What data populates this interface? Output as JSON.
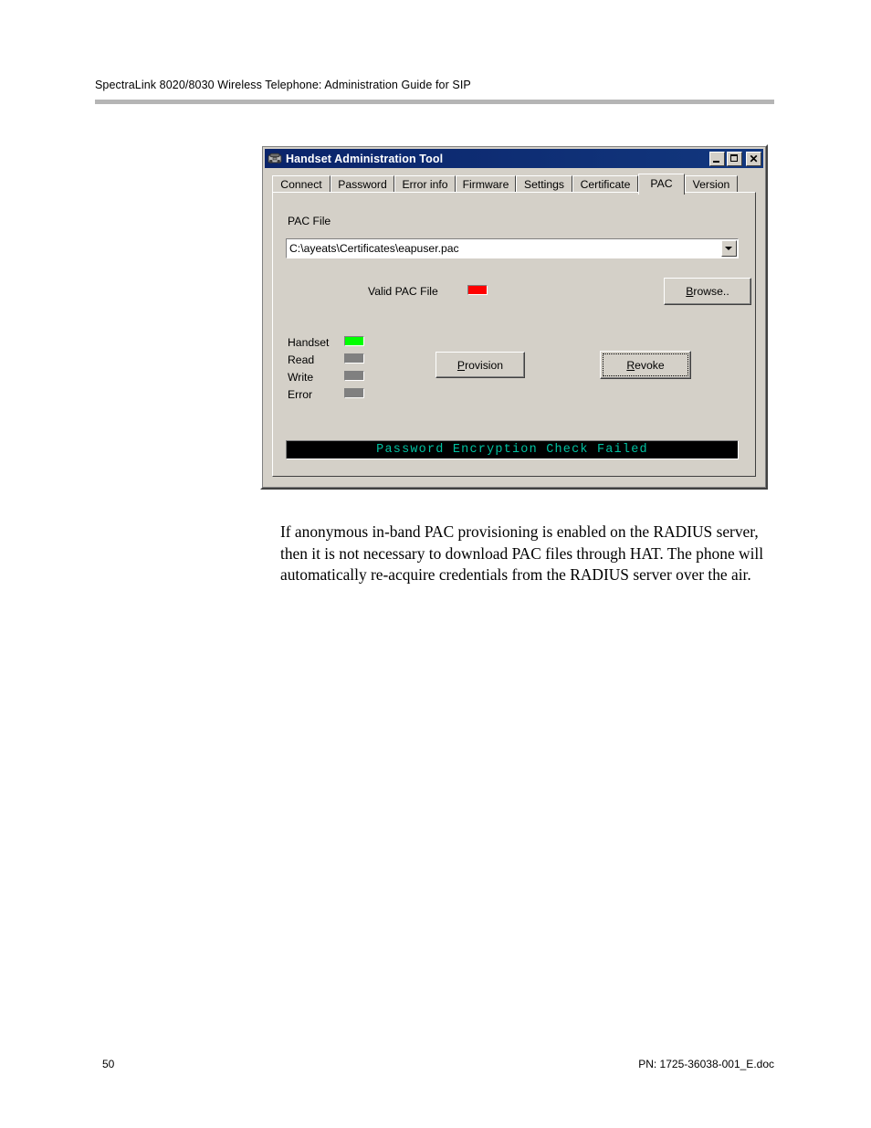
{
  "page": {
    "header_text": "SpectraLink 8020/8030 Wireless Telephone: Administration Guide for SIP",
    "footer_page_number": "50",
    "footer_document_id": "PN: 1725-36038-001_E.doc",
    "body_paragraph": "If anonymous in-band PAC provisioning is enabled on the RADIUS server, then it is not necessary to download PAC files through HAT. The phone will automatically re-acquire credentials from the RADIUS server over the air."
  },
  "dialog": {
    "title": "Handset Administration Tool",
    "title_icon": "telephone-handset-icon",
    "window_controls": {
      "minimize": "minimize-icon",
      "maximize": "maximize-icon",
      "close": "close-icon"
    },
    "tabs": [
      {
        "label": "Connect",
        "active": false
      },
      {
        "label": "Password",
        "active": false
      },
      {
        "label": "Error info",
        "active": false
      },
      {
        "label": "Firmware",
        "active": false
      },
      {
        "label": "Settings",
        "active": false
      },
      {
        "label": "Certificate",
        "active": false
      },
      {
        "label": "PAC",
        "active": true
      },
      {
        "label": "Version",
        "active": false
      }
    ],
    "pac_tab": {
      "pac_file_label": "PAC File",
      "pac_file_value": "C:\\ayeats\\Certificates\\eapuser.pac",
      "dropdown_icon": "chevron-down-icon",
      "valid_pac_label": "Valid PAC File",
      "valid_pac_led_color": "#ff0000",
      "browse_button": {
        "prefix": "",
        "accel": "B",
        "suffix": "rowse.."
      },
      "indicators": [
        {
          "label": "Handset",
          "color": "#00ff00"
        },
        {
          "label": "Read",
          "color": "#808080"
        },
        {
          "label": "Write",
          "color": "#808080"
        },
        {
          "label": "Error",
          "color": "#808080"
        }
      ],
      "provision_button": {
        "prefix": "",
        "accel": "P",
        "suffix": "rovision",
        "focused": false
      },
      "revoke_button": {
        "prefix": "",
        "accel": "R",
        "suffix": "evoke",
        "focused": true
      },
      "status_message": "Password Encryption Check Failed",
      "status_text_color": "#00c0a0"
    }
  }
}
